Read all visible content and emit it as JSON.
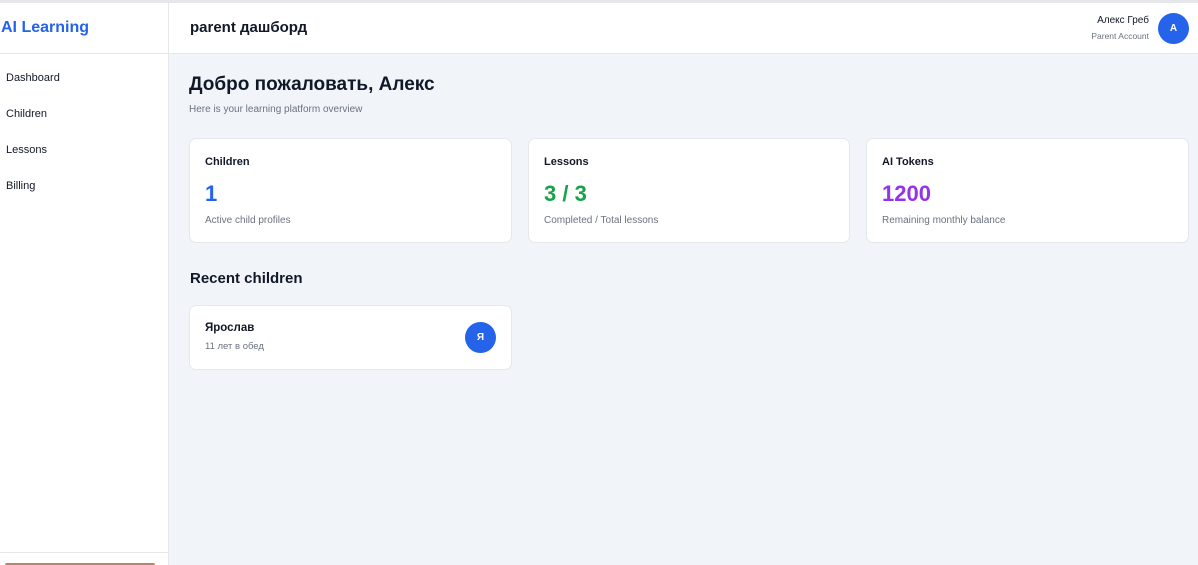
{
  "app": {
    "brand": "AI Learning"
  },
  "sidebar": {
    "items": [
      {
        "label": "Dashboard"
      },
      {
        "label": "Children"
      },
      {
        "label": "Lessons"
      },
      {
        "label": "Billing"
      }
    ]
  },
  "header": {
    "title": "parent дашборд",
    "user_name": "Алекс Греб",
    "user_role": "Parent Account",
    "avatar_initial": "А"
  },
  "main": {
    "welcome": "Добро пожаловать, Алекс",
    "subtitle": "Here is your learning platform overview",
    "stats": [
      {
        "label": "Children",
        "value": "1",
        "desc": "Active child profiles",
        "color": "#2563eb"
      },
      {
        "label": "Lessons",
        "value": "3 / 3",
        "desc": "Completed / Total lessons",
        "color": "#16a34a"
      },
      {
        "label": "AI Tokens",
        "value": "1200",
        "desc": "Remaining monthly balance",
        "color": "#9333ea"
      }
    ],
    "recent_title": "Recent children",
    "children": [
      {
        "name": "Ярослав",
        "age": "11 лет в обед",
        "initial": "Я"
      }
    ]
  },
  "colors": {
    "accent": "#2563eb",
    "background": "#f1f4f8"
  }
}
